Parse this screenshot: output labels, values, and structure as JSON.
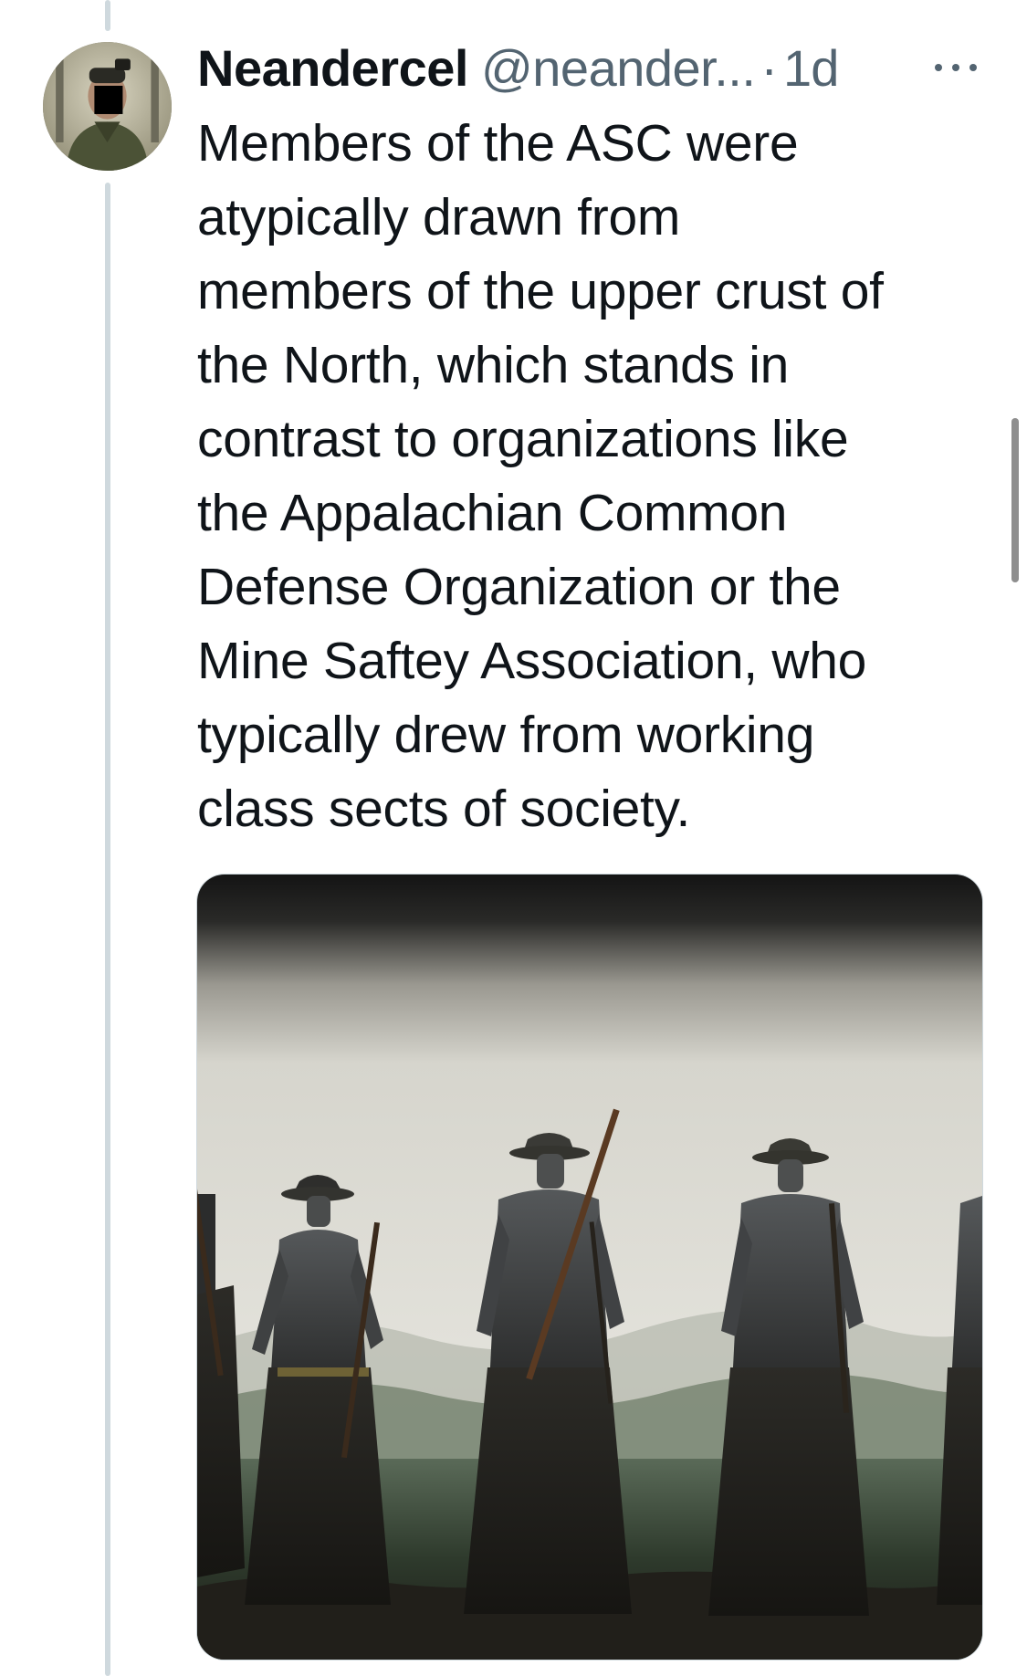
{
  "tweet": {
    "display_name": "Neandercel",
    "handle": "@neander...",
    "separator": "·",
    "time": "1d",
    "lines": [
      "Members of the ASC were",
      "atypically drawn from",
      "members of the upper crust of",
      "the North, which stands in",
      "contrast to organizations like",
      "the Appalachian Common",
      "Defense Organization or the",
      "Mine Saftey Association, who",
      "typically drew from working",
      "class sects of society."
    ]
  },
  "icons": {
    "more": "more-horizontal-icon"
  },
  "colors": {
    "text": "#0f1419",
    "secondary": "#536471",
    "thread_line": "#cfd9de"
  }
}
